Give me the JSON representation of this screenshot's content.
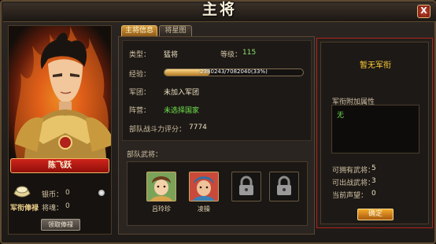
{
  "window": {
    "title": "主将",
    "close_label": "X"
  },
  "hero": {
    "name": "陈飞跃"
  },
  "resources": {
    "silver_label": "银币：",
    "silver_value": "0",
    "general_soul_label": "将魂：",
    "general_soul_value": "0",
    "salary_label": "军衔俸禄",
    "claim_button": "领取俸禄"
  },
  "tabs": [
    {
      "label": "主将信息",
      "active": true
    },
    {
      "label": "将星图",
      "active": false
    }
  ],
  "info": {
    "type_label": "类型：",
    "type_value": "猛将",
    "level_label": "等级：",
    "level_value": "115",
    "exp_label": "经验：",
    "exp_text": "2380243/7082040(33%)",
    "exp_fraction": 0.33,
    "corps_label": "军团：",
    "corps_value": "未加入军团",
    "camp_label": "阵营：",
    "camp_value": "未选择国家",
    "power_label": "部队战斗力评分：",
    "power_value": "7774"
  },
  "troops": {
    "label": "部队武将：",
    "slots": [
      {
        "name": "吕玲珍",
        "filled": true,
        "icon": "hero-portrait-icon"
      },
      {
        "name": "凌操",
        "filled": true,
        "icon": "hero-portrait-icon"
      },
      {
        "name": "",
        "filled": false,
        "icon": "lock-icon"
      },
      {
        "name": "",
        "filled": false,
        "icon": "lock-icon"
      }
    ]
  },
  "rank": {
    "title": "暂无军衔",
    "bonus_label": "军衔附加属性",
    "bonus_value": "无",
    "owned_label": "可拥有武将：",
    "owned_value": "5",
    "deploy_label": "可出战武将：",
    "deploy_value": "3",
    "prestige_label": "当前声望：",
    "prestige_value": "0",
    "confirm_button": "确定"
  },
  "colors": {
    "accent_gold": "#ffcf38",
    "green_text": "#6fe24b",
    "red_border": "#b3231b"
  }
}
